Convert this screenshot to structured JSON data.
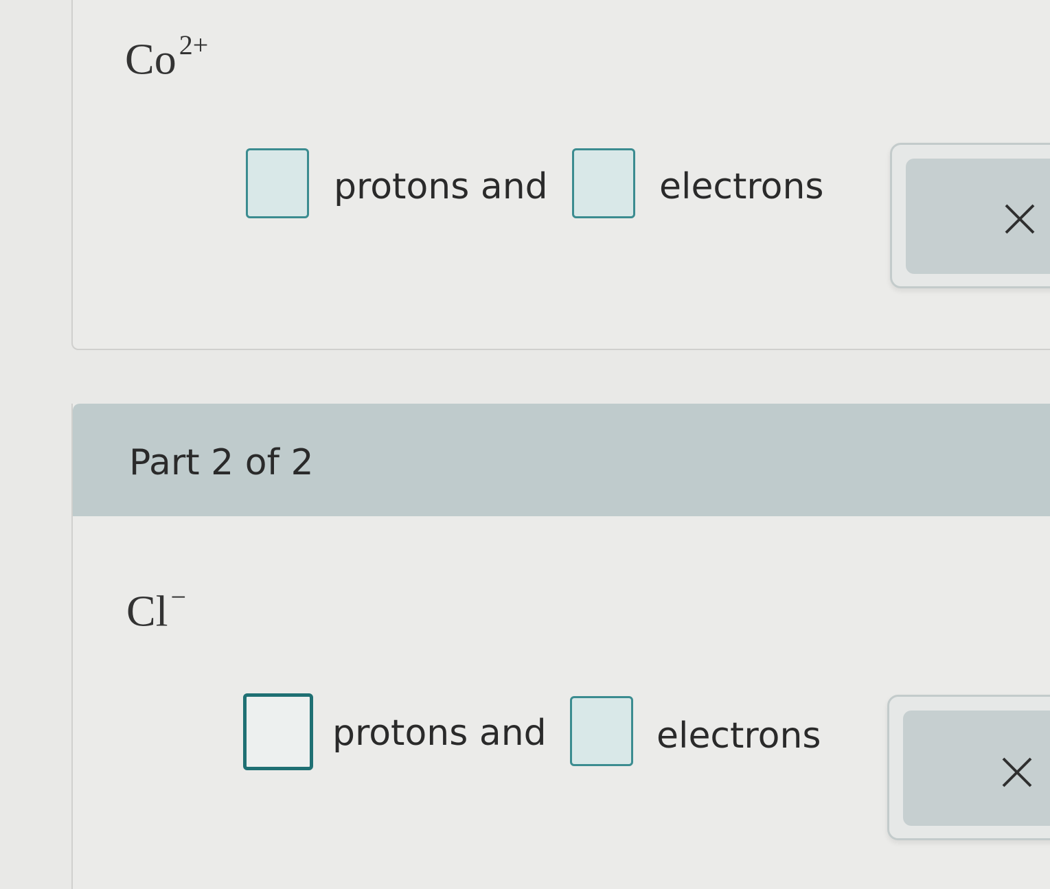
{
  "part1": {
    "ion_symbol": "Co",
    "ion_charge": "2+",
    "protons_text": "protons and",
    "electrons_text": "electrons",
    "feedback_icon": "close-icon"
  },
  "part2": {
    "header": "Part 2 of 2",
    "ion_symbol": "Cl",
    "ion_charge": "−",
    "protons_text": "protons and",
    "electrons_text": "electrons",
    "feedback_icon": "close-icon"
  },
  "colors": {
    "header_bg": "#bfcbcc",
    "box_border": "#3b8c90",
    "box_fill": "#d9e8e8",
    "page_bg": "#e9e9e7"
  }
}
